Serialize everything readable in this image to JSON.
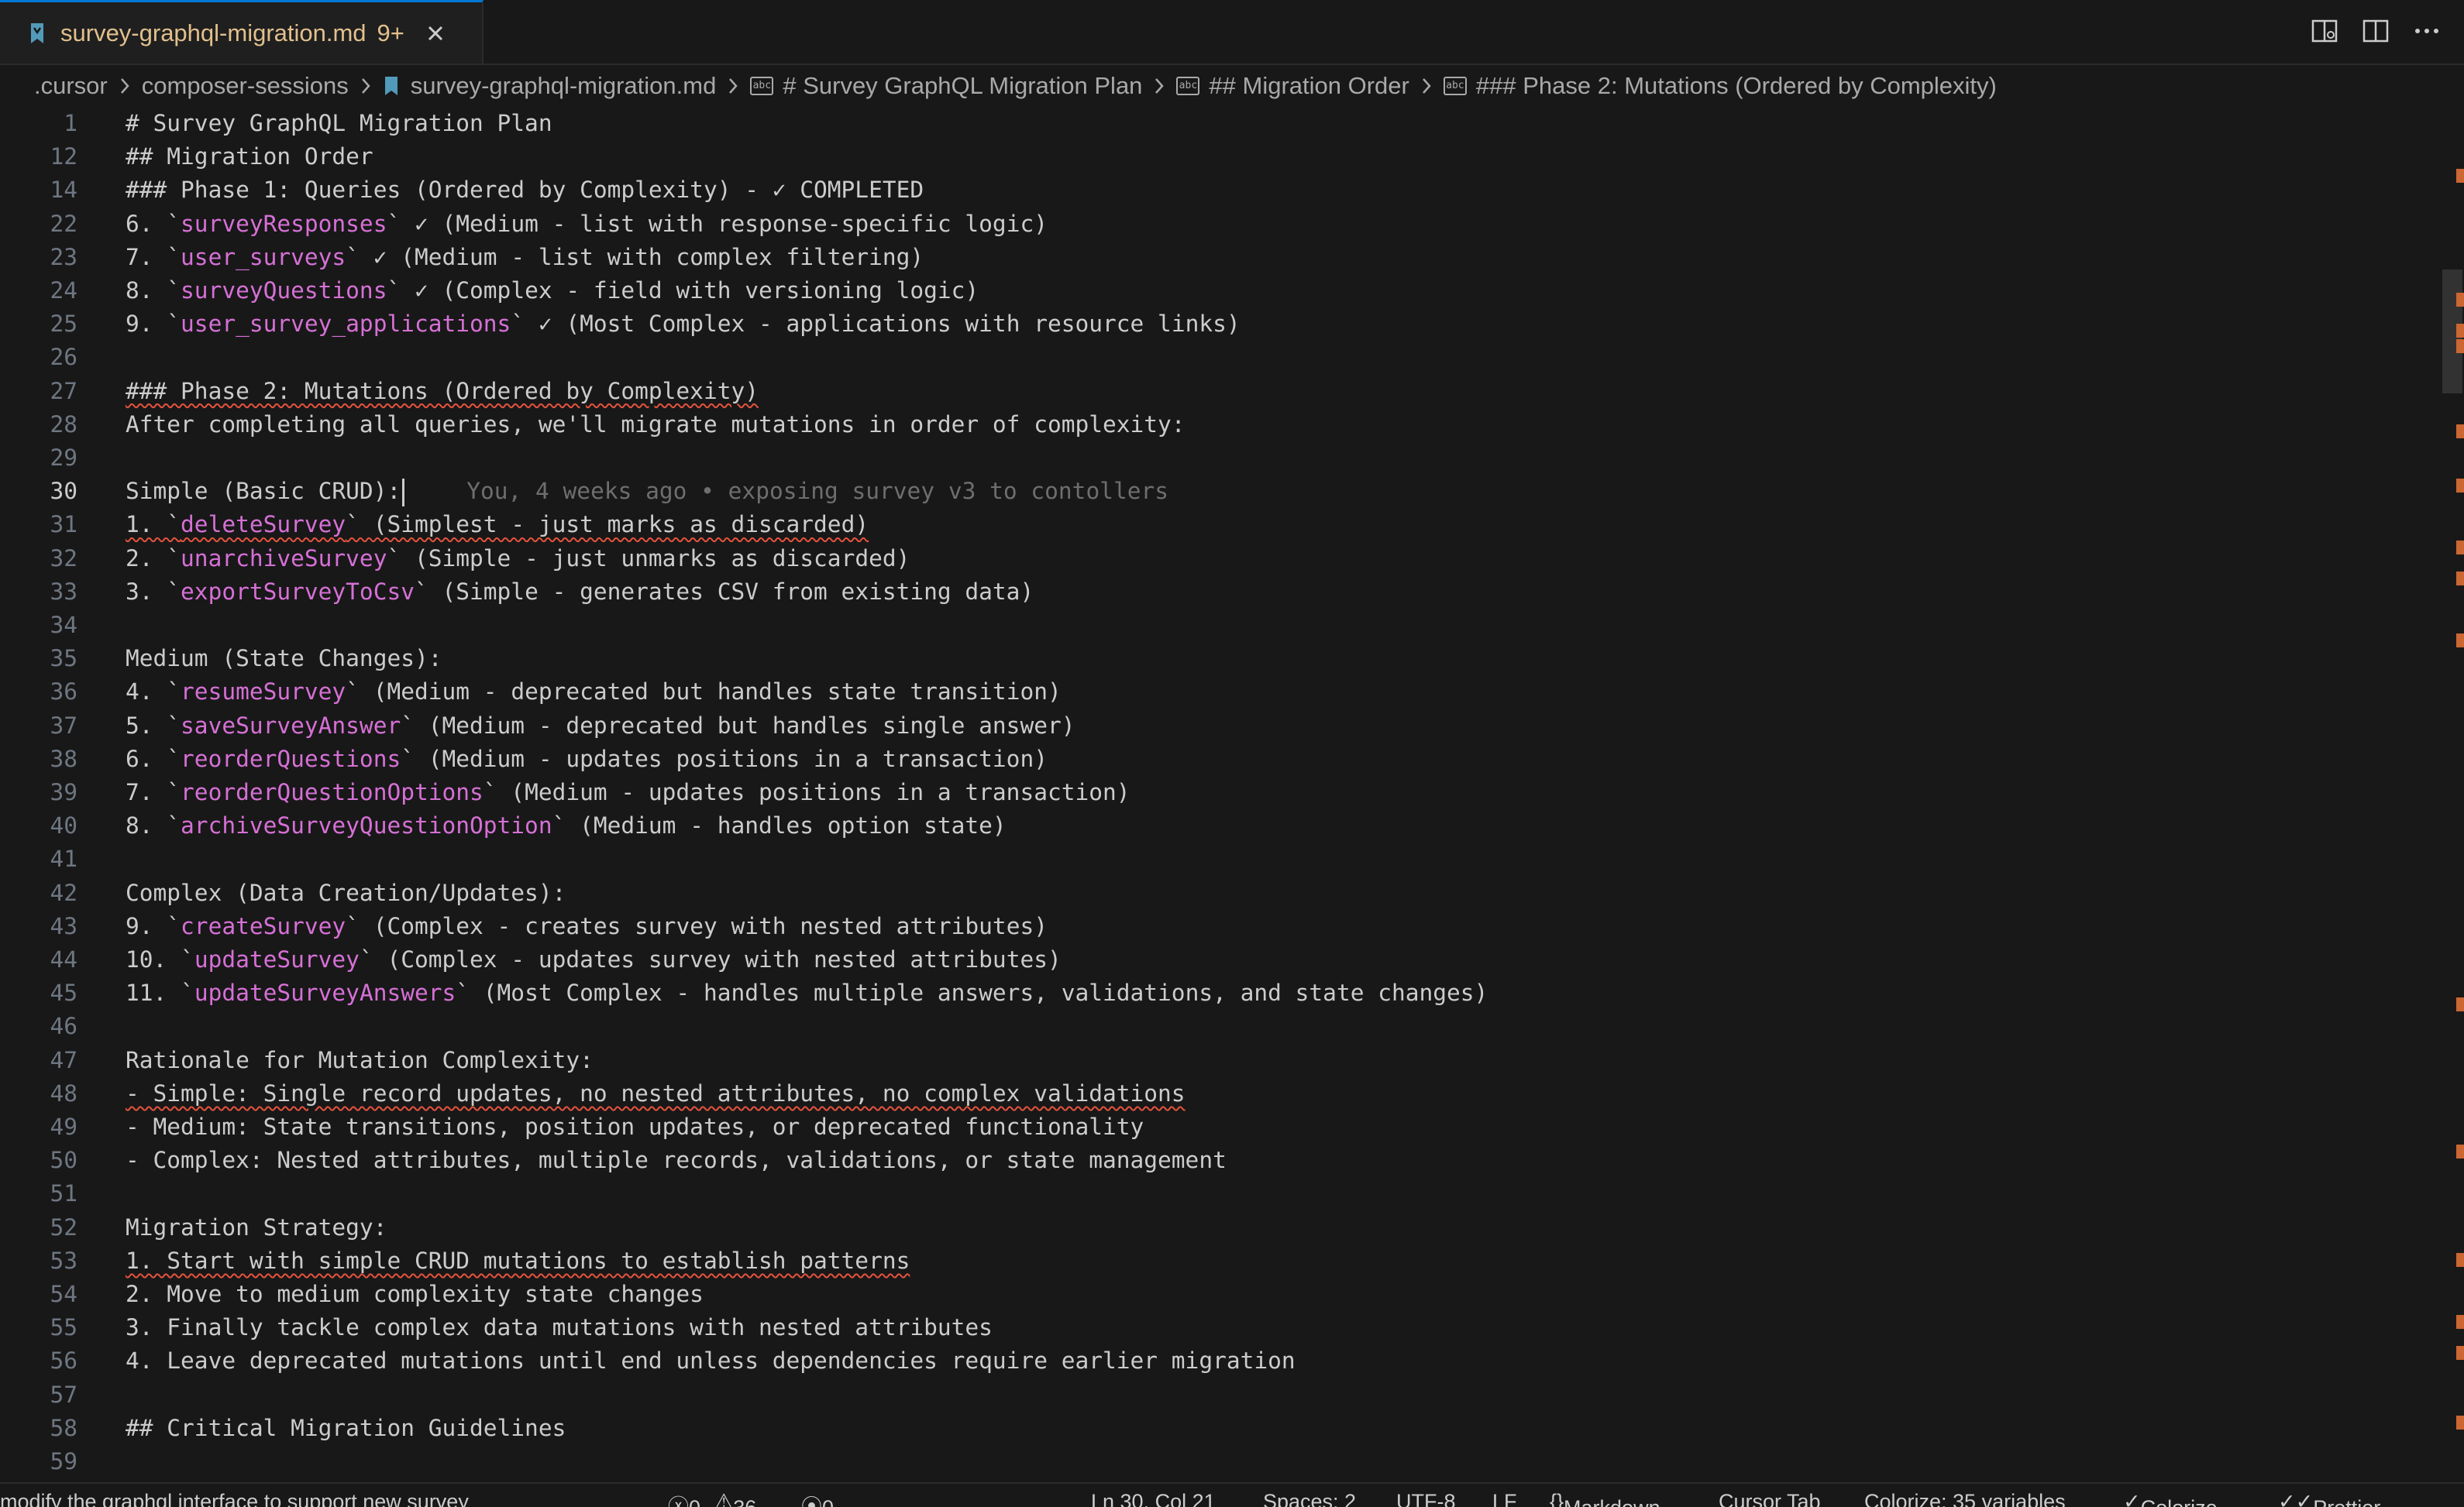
{
  "tab": {
    "title": "survey-graphql-migration.md",
    "badge": "9+"
  },
  "breadcrumb": [
    ".cursor",
    "composer-sessions",
    "survey-graphql-migration.md",
    "# Survey GraphQL Migration Plan",
    "## Migration Order",
    "### Phase 2: Mutations (Ordered by Complexity)"
  ],
  "blame": "You, 4 weeks ago • exposing survey v3 to contollers",
  "lines": [
    {
      "n": "1",
      "segs": [
        {
          "t": "# Survey GraphQL Migration Plan"
        }
      ]
    },
    {
      "n": "12",
      "segs": [
        {
          "t": "## Migration Order"
        }
      ]
    },
    {
      "n": "14",
      "segs": [
        {
          "t": "### Phase 1: Queries (Ordered by Complexity) - ✓ COMPLETED"
        }
      ]
    },
    {
      "n": "22",
      "segs": [
        {
          "t": "6. `"
        },
        {
          "t": "surveyResponses",
          "c": "fn2"
        },
        {
          "t": "` ✓ (Medium - list with response-specific logic)"
        }
      ]
    },
    {
      "n": "23",
      "segs": [
        {
          "t": "7. `"
        },
        {
          "t": "user_surveys",
          "c": "fn2"
        },
        {
          "t": "` ✓ (Medium - list with complex filtering)"
        }
      ]
    },
    {
      "n": "24",
      "segs": [
        {
          "t": "8. `"
        },
        {
          "t": "surveyQuestions",
          "c": "fn2"
        },
        {
          "t": "` ✓ (Complex - field with versioning logic)"
        }
      ]
    },
    {
      "n": "25",
      "segs": [
        {
          "t": "9. `"
        },
        {
          "t": "user_survey_applications",
          "c": "fn2"
        },
        {
          "t": "` ✓ (Most Complex - applications with resource links)"
        }
      ]
    },
    {
      "n": "26",
      "segs": []
    },
    {
      "n": "27",
      "segs": [
        {
          "t": "### Phase 2: Mutations (Ordered by Complexity)",
          "w": true
        }
      ]
    },
    {
      "n": "28",
      "segs": [
        {
          "t": "After completing all queries, we'll migrate mutations in order of complexity:"
        }
      ]
    },
    {
      "n": "29",
      "segs": []
    },
    {
      "n": "30",
      "cur": true,
      "segs": [
        {
          "t": "Simple (Basic CRUD):"
        }
      ]
    },
    {
      "n": "31",
      "segs": [
        {
          "t": "1. `",
          "w": true
        },
        {
          "t": "deleteSurvey",
          "c": "fn2",
          "w": true
        },
        {
          "t": "` (Simplest - just marks as discarded)",
          "w": true
        }
      ]
    },
    {
      "n": "32",
      "segs": [
        {
          "t": "2. `"
        },
        {
          "t": "unarchiveSurvey",
          "c": "fn2"
        },
        {
          "t": "` (Simple - just unmarks as discarded)"
        }
      ]
    },
    {
      "n": "33",
      "segs": [
        {
          "t": "3. `"
        },
        {
          "t": "exportSurveyToCsv",
          "c": "fn2"
        },
        {
          "t": "` (Simple - generates CSV from existing data)"
        }
      ]
    },
    {
      "n": "34",
      "segs": []
    },
    {
      "n": "35",
      "segs": [
        {
          "t": "Medium (State Changes):"
        }
      ]
    },
    {
      "n": "36",
      "segs": [
        {
          "t": "4. `"
        },
        {
          "t": "resumeSurvey",
          "c": "fn2"
        },
        {
          "t": "` (Medium - deprecated but handles state transition)"
        }
      ]
    },
    {
      "n": "37",
      "segs": [
        {
          "t": "5. `"
        },
        {
          "t": "saveSurveyAnswer",
          "c": "fn2"
        },
        {
          "t": "` (Medium - deprecated but handles single answer)"
        }
      ]
    },
    {
      "n": "38",
      "segs": [
        {
          "t": "6. `"
        },
        {
          "t": "reorderQuestions",
          "c": "fn2"
        },
        {
          "t": "` (Medium - updates positions in a transaction)"
        }
      ]
    },
    {
      "n": "39",
      "segs": [
        {
          "t": "7. `"
        },
        {
          "t": "reorderQuestionOptions",
          "c": "fn2"
        },
        {
          "t": "` (Medium - updates positions in a transaction)"
        }
      ]
    },
    {
      "n": "40",
      "segs": [
        {
          "t": "8. `"
        },
        {
          "t": "archiveSurveyQuestionOption",
          "c": "fn2"
        },
        {
          "t": "` (Medium - handles option state)"
        }
      ]
    },
    {
      "n": "41",
      "segs": []
    },
    {
      "n": "42",
      "segs": [
        {
          "t": "Complex (Data Creation/Updates):"
        }
      ]
    },
    {
      "n": "43",
      "segs": [
        {
          "t": "9. `"
        },
        {
          "t": "createSurvey",
          "c": "fn2"
        },
        {
          "t": "` (Complex - creates survey with nested attributes)"
        }
      ]
    },
    {
      "n": "44",
      "segs": [
        {
          "t": "10. `"
        },
        {
          "t": "updateSurvey",
          "c": "fn2"
        },
        {
          "t": "` (Complex - updates survey with nested attributes)"
        }
      ]
    },
    {
      "n": "45",
      "segs": [
        {
          "t": "11. `"
        },
        {
          "t": "updateSurveyAnswers",
          "c": "fn2"
        },
        {
          "t": "` (Most Complex - handles multiple answers, validations, and state changes)"
        }
      ]
    },
    {
      "n": "46",
      "segs": []
    },
    {
      "n": "47",
      "segs": [
        {
          "t": "Rationale for Mutation Complexity:"
        }
      ]
    },
    {
      "n": "48",
      "segs": [
        {
          "t": "- Simple: Single record updates, no nested attributes, no complex validations",
          "w": true
        }
      ]
    },
    {
      "n": "49",
      "segs": [
        {
          "t": "- Medium: State transitions, position updates, or deprecated functionality"
        }
      ]
    },
    {
      "n": "50",
      "segs": [
        {
          "t": "- Complex: Nested attributes, multiple records, validations, or state management"
        }
      ]
    },
    {
      "n": "51",
      "segs": []
    },
    {
      "n": "52",
      "segs": [
        {
          "t": "Migration Strategy:"
        }
      ]
    },
    {
      "n": "53",
      "segs": [
        {
          "t": "1. Start with simple CRUD mutations to establish patterns",
          "w": true
        }
      ]
    },
    {
      "n": "54",
      "segs": [
        {
          "t": "2. Move to medium complexity state changes"
        }
      ]
    },
    {
      "n": "55",
      "segs": [
        {
          "t": "3. Finally tackle complex data mutations with nested attributes"
        }
      ]
    },
    {
      "n": "56",
      "segs": [
        {
          "t": "4. Leave deprecated mutations until end unless dependencies require earlier migration"
        }
      ]
    },
    {
      "n": "57",
      "segs": []
    },
    {
      "n": "58",
      "segs": [
        {
          "t": "## Critical Migration Guidelines"
        }
      ]
    },
    {
      "n": "59",
      "segs": []
    }
  ],
  "status": {
    "branch": "modify the graphql interface to support new survey",
    "errors": "0",
    "warnings": "36",
    "ports": "0",
    "position": "Ln 30, Col 21",
    "spaces": "Spaces: 2",
    "encoding": "UTF-8",
    "eol": "LF",
    "language": "Markdown",
    "cursor_tab": "Cursor Tab",
    "colorize_vars": "Colorize: 35 variables",
    "colorize": "Colorize",
    "prettier": "Prettier"
  },
  "colors": {
    "bg": "#181818",
    "tab_text": "#e2c08d",
    "code_ident": "#d670d6",
    "error_wave": "#e5533d",
    "accent": "#0078d4"
  }
}
